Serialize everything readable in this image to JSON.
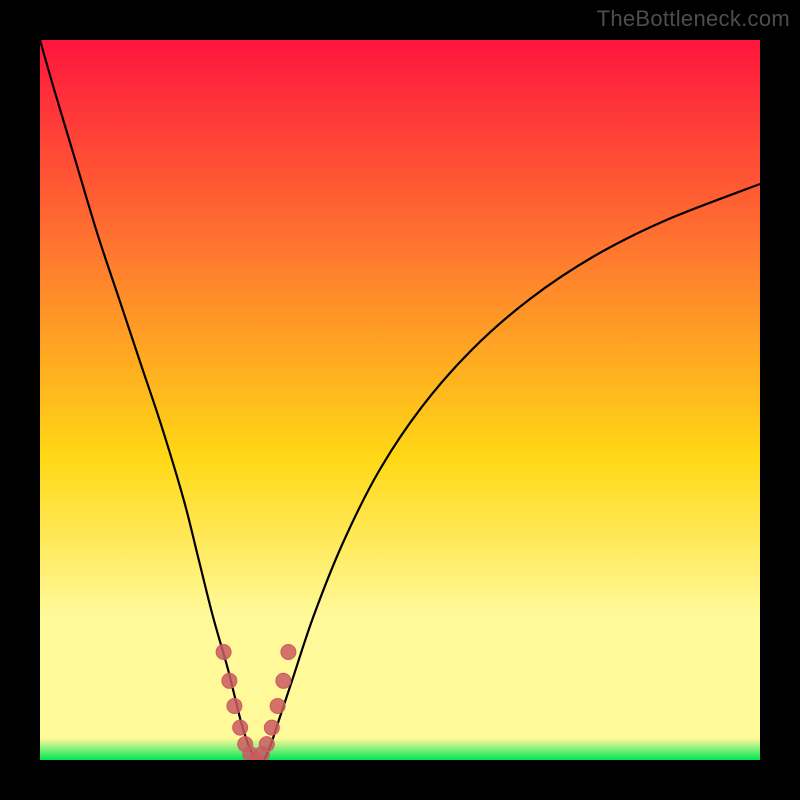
{
  "watermark": "TheBottleneck.com",
  "colors": {
    "background": "#000000",
    "gradient_top": "#ff153e",
    "gradient_mid_upper": "#ff7a2e",
    "gradient_mid": "#ffd815",
    "gradient_lower": "#fff99a",
    "gradient_bottom": "#00e756",
    "curve_stroke": "#000000",
    "dot_stroke": "#ca5a61",
    "dot_fill": "#ca5a61"
  },
  "chart_data": {
    "type": "line",
    "title": "",
    "xlabel": "",
    "ylabel": "",
    "xlim": [
      0,
      100
    ],
    "ylim": [
      0,
      100
    ],
    "series": [
      {
        "name": "bottleneck-curve",
        "x": [
          0,
          2,
          5,
          8,
          11,
          14,
          17,
          20,
          22,
          24,
          26,
          27,
          28,
          29,
          30,
          31,
          32,
          33,
          35,
          38,
          42,
          47,
          53,
          60,
          68,
          77,
          87,
          100
        ],
        "y": [
          100,
          93,
          83,
          73,
          64,
          55,
          46,
          36,
          28,
          20,
          13,
          9,
          5,
          2,
          0,
          0,
          2,
          5,
          11,
          20,
          30,
          40,
          49,
          57,
          64,
          70,
          75,
          80
        ]
      }
    ],
    "highlight_points": {
      "name": "trough-highlight",
      "x": [
        25.5,
        26.3,
        27.0,
        27.8,
        28.5,
        29.2,
        30.0,
        30.8,
        31.5,
        32.2,
        33.0,
        33.8,
        34.5
      ],
      "y": [
        15,
        11,
        7.5,
        4.5,
        2.2,
        0.8,
        0,
        0.8,
        2.2,
        4.5,
        7.5,
        11,
        15
      ]
    }
  }
}
